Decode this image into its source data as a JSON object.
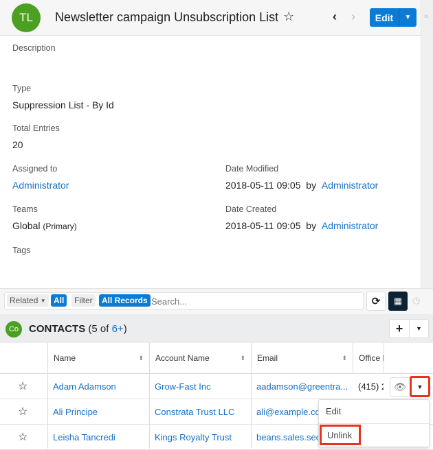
{
  "header": {
    "avatar": "TL",
    "title": "Newsletter campaign Unsubscription List",
    "edit_label": "Edit"
  },
  "fields": {
    "description_label": "Description",
    "type_label": "Type",
    "type_value": "Suppression List - By Id",
    "total_label": "Total Entries",
    "total_value": "20",
    "assigned_label": "Assigned to",
    "assigned_value": "Administrator",
    "modified_label": "Date Modified",
    "modified_date": "2018-05-11 09:05",
    "modified_by": "by",
    "modified_user": "Administrator",
    "teams_label": "Teams",
    "teams_value": "Global",
    "teams_primary": "(Primary)",
    "created_label": "Date Created",
    "created_date": "2018-05-11 09:05",
    "created_by": "by",
    "created_user": "Administrator",
    "tags_label": "Tags"
  },
  "toolbar": {
    "related": "Related",
    "related_value": "All",
    "filter": "Filter",
    "filter_value": "All Records",
    "search_placeholder": "Search..."
  },
  "subpanel": {
    "avatar": "Co",
    "title": "CONTACTS",
    "count_prefix": "(5 of ",
    "count_more": "6+",
    "count_suffix": ")"
  },
  "table": {
    "columns": [
      "Name",
      "Account Name",
      "Email",
      "Office P"
    ],
    "rows": [
      {
        "name": "Adam Adamson",
        "account": "Grow-Fast Inc",
        "email": "aadamson@greentra...",
        "phone": "(415) 2"
      },
      {
        "name": "Ali Principe",
        "account": "Constrata Trust LLC",
        "email": "ali@example.com",
        "phone": ""
      },
      {
        "name": "Leisha Tancredi",
        "account": "Kings Royalty Trust",
        "email": "beans.sales.sect",
        "phone": ""
      }
    ]
  },
  "row_menu": {
    "edit": "Edit",
    "unlink": "Unlink"
  },
  "colors": {
    "accent": "#0b7bd3",
    "avatar": "#4ca021",
    "highlight": "#e8321f"
  }
}
